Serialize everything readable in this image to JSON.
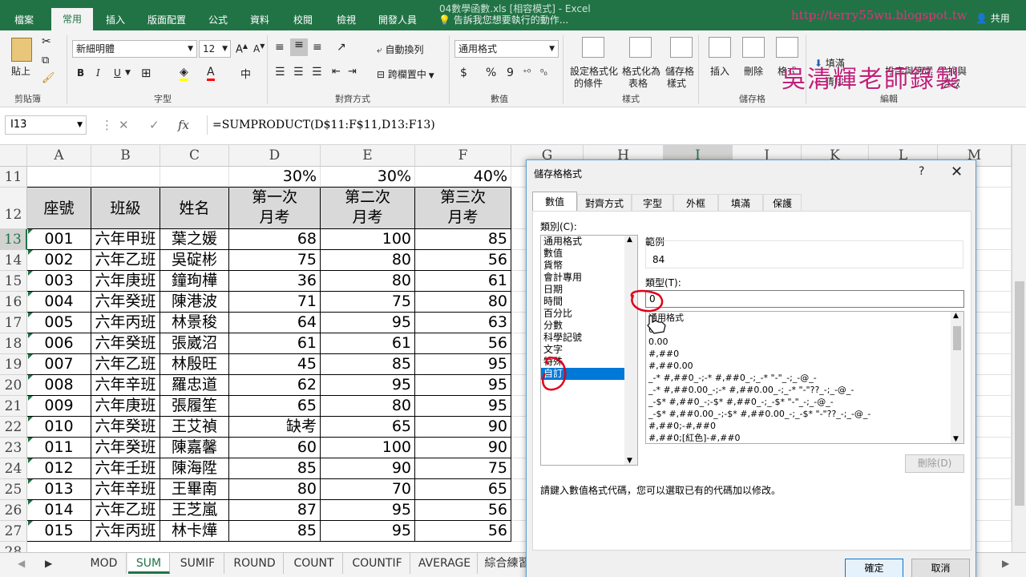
{
  "titlebar": {
    "tabs": [
      "檔案",
      "常用",
      "插入",
      "版面配置",
      "公式",
      "資料",
      "校閱",
      "檢視",
      "開發人員"
    ],
    "window_title": "04數學函數.xls  [相容模式] - Excel",
    "tell_me": "告訴我您想要執行的動作...",
    "share": "共用",
    "watermark_url": "http://terry55wu.blogspot.tw",
    "watermark_name": "吳清輝老師錄製"
  },
  "ribbon": {
    "clipboard": {
      "paste": "貼上",
      "group": "剪貼簿"
    },
    "font": {
      "name": "新細明體",
      "size": "12",
      "bold": "B",
      "italic": "I",
      "underline": "U",
      "group": "字型"
    },
    "alignment": {
      "wrap": "自動換列",
      "merge": "跨欄置中",
      "group": "對齊方式"
    },
    "number": {
      "format": "通用格式",
      "currency": "$",
      "percent": "%",
      "comma": "9",
      "group": "數值"
    },
    "styles": {
      "conditional": "設定格式化的條件",
      "conditional_2": "的條件",
      "as_table": "格式化為",
      "as_table_2": "表格",
      "cell_styles": "儲存格",
      "cell_styles_2": "樣式",
      "group": "樣式"
    },
    "cells": {
      "insert": "插入",
      "delete": "刪除",
      "format": "格式",
      "group": "儲存格"
    },
    "editing": {
      "fill": "填滿",
      "clear": "清除",
      "sort": "排序與篩選",
      "find": "尋找與",
      "find_2": "選取",
      "group": "編輯"
    }
  },
  "formula_bar": {
    "name_box": "I13",
    "formula": "=SUMPRODUCT(D$11:F$11,D13:F13)",
    "fx": "fx"
  },
  "grid": {
    "columns": [
      "A",
      "B",
      "C",
      "D",
      "E",
      "F",
      "G",
      "H",
      "I",
      "J",
      "K",
      "L",
      "M"
    ],
    "selected_column": "I",
    "weights": [
      "30%",
      "30%",
      "40%"
    ],
    "header": [
      "座號",
      "班級",
      "姓名",
      "第一次",
      "月考",
      "第二次",
      "月考",
      "第三次",
      "月考"
    ],
    "rows": [
      {
        "row": "13",
        "id": "001",
        "cls": "六年甲班",
        "name": "葉之媛",
        "d": "68",
        "e": "100",
        "f": "85"
      },
      {
        "row": "14",
        "id": "002",
        "cls": "六年乙班",
        "name": "吳碇彬",
        "d": "75",
        "e": "80",
        "f": "56"
      },
      {
        "row": "15",
        "id": "003",
        "cls": "六年庚班",
        "name": "鐘珣樺",
        "d": "36",
        "e": "80",
        "f": "61"
      },
      {
        "row": "16",
        "id": "004",
        "cls": "六年癸班",
        "name": "陳港波",
        "d": "71",
        "e": "75",
        "f": "80"
      },
      {
        "row": "17",
        "id": "005",
        "cls": "六年丙班",
        "name": "林景稄",
        "d": "64",
        "e": "95",
        "f": "63"
      },
      {
        "row": "18",
        "id": "006",
        "cls": "六年癸班",
        "name": "張崴沼",
        "d": "61",
        "e": "61",
        "f": "56"
      },
      {
        "row": "19",
        "id": "007",
        "cls": "六年乙班",
        "name": "林殷旺",
        "d": "45",
        "e": "85",
        "f": "95"
      },
      {
        "row": "20",
        "id": "008",
        "cls": "六年辛班",
        "name": "羅忠道",
        "d": "62",
        "e": "95",
        "f": "95"
      },
      {
        "row": "21",
        "id": "009",
        "cls": "六年庚班",
        "name": "張履笙",
        "d": "65",
        "e": "80",
        "f": "95"
      },
      {
        "row": "22",
        "id": "010",
        "cls": "六年癸班",
        "name": "王艾禎",
        "d": "缺考",
        "e": "65",
        "f": "90"
      },
      {
        "row": "23",
        "id": "011",
        "cls": "六年癸班",
        "name": "陳嘉馨",
        "d": "60",
        "e": "100",
        "f": "90"
      },
      {
        "row": "24",
        "id": "012",
        "cls": "六年壬班",
        "name": "陳海陞",
        "d": "85",
        "e": "90",
        "f": "75"
      },
      {
        "row": "25",
        "id": "013",
        "cls": "六年辛班",
        "name": "王畢南",
        "d": "80",
        "e": "70",
        "f": "65"
      },
      {
        "row": "26",
        "id": "014",
        "cls": "六年乙班",
        "name": "王芝嵐",
        "d": "87",
        "e": "95",
        "f": "56"
      },
      {
        "row": "27",
        "id": "015",
        "cls": "六年丙班",
        "name": "林卡燁",
        "d": "85",
        "e": "95",
        "f": "56"
      }
    ],
    "row_11": "11",
    "row_12": "12",
    "row_28": "28"
  },
  "sheet_tabs": [
    "MOD",
    "SUM",
    "SUMIF",
    "ROUND",
    "COUNT",
    "COUNTIF",
    "AVERAGE",
    "綜合練習"
  ],
  "active_sheet": "SUM",
  "dialog": {
    "title": "儲存格格式",
    "help": "?",
    "close": "✕",
    "tabs": [
      "數值",
      "對齊方式",
      "字型",
      "外框",
      "填滿",
      "保護"
    ],
    "category_label": "類別(C):",
    "categories": [
      "通用格式",
      "數值",
      "貨幣",
      "會計專用",
      "日期",
      "時間",
      "百分比",
      "分數",
      "科學記號",
      "文字",
      "特殊",
      "自訂"
    ],
    "selected_category": "自訂",
    "sample_label": "範例",
    "sample_value": "84",
    "type_label": "類型(T):",
    "type_value": "0",
    "formats": [
      "通用格式",
      "0",
      "0.00",
      "#,##0",
      "#,##0.00",
      "_-* #,##0_-;-* #,##0_-;_-* \"-\"_-;_-@_-",
      "_-* #,##0.00_-;-* #,##0.00_-;_-* \"-\"??_-;_-@_-",
      "_-$* #,##0_-;-$* #,##0_-;_-$* \"-\"_-;_-@_-",
      "_-$* #,##0.00_-;-$* #,##0.00_-;_-$* \"-\"??_-;_-@_-",
      "#,##0;-#,##0",
      "#,##0;[紅色]-#,##0"
    ],
    "delete_button": "刪除(D)",
    "hint": "請鍵入數值格式代碼，您可以選取已有的代碼加以修改。",
    "ok": "確定",
    "cancel": "取消"
  },
  "colors": {
    "excel_green": "#217346",
    "selection_blue": "#0078d7",
    "annotation_red": "#e0001a"
  }
}
